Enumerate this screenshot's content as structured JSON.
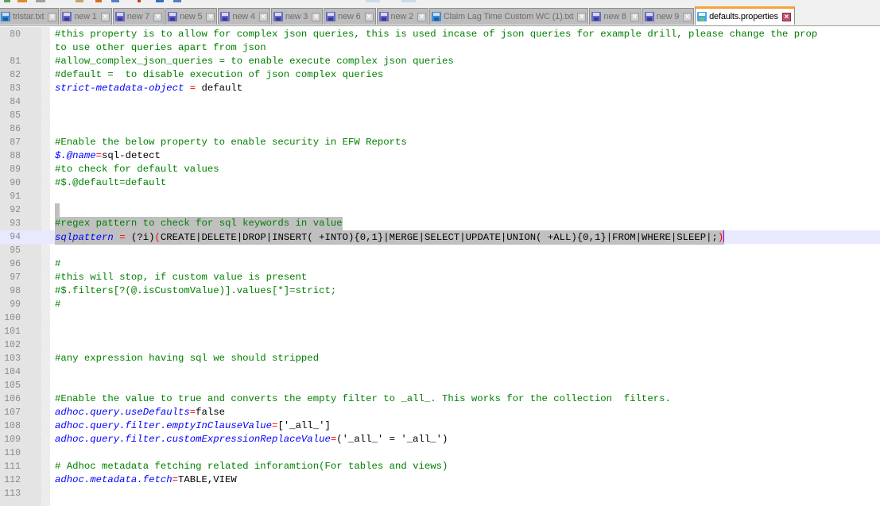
{
  "tabs": [
    {
      "label": "tristar.txt",
      "icon": "floppy-save-icon",
      "active": false
    },
    {
      "label": "new 1",
      "icon": "floppy-save-icon",
      "active": false
    },
    {
      "label": "new 7",
      "icon": "floppy-save-icon",
      "active": false
    },
    {
      "label": "new 5",
      "icon": "floppy-save-icon",
      "active": false
    },
    {
      "label": "new 4",
      "icon": "floppy-save-icon",
      "active": false
    },
    {
      "label": "new 3",
      "icon": "floppy-save-icon",
      "active": false
    },
    {
      "label": "new 6",
      "icon": "floppy-save-icon",
      "active": false
    },
    {
      "label": "new 2",
      "icon": "floppy-save-icon",
      "active": false
    },
    {
      "label": "Claim Lag Time Custom WC (1).txt",
      "icon": "floppy-save-icon",
      "active": false
    },
    {
      "label": "new 8",
      "icon": "floppy-save-icon",
      "active": false
    },
    {
      "label": "new 9",
      "icon": "floppy-save-icon",
      "active": false
    },
    {
      "label": "defaults.properties",
      "icon": "floppy-save-icon",
      "active": true
    }
  ],
  "colors": {
    "active_tab_accent": "#f7a13b",
    "comment": "#008000",
    "key": "#0000ff",
    "operator": "#ff0000",
    "selection": "#c0c0c0",
    "current_line": "#e8e8ff"
  },
  "editor": {
    "lines": [
      {
        "n": "80",
        "parts": [
          {
            "t": "comment",
            "v": "#this property is to allow for complex json queries, this is used incase of json queries for example drill, please change the prop"
          }
        ]
      },
      {
        "n": "",
        "parts": [
          {
            "t": "comment",
            "v": "to use other queries apart from json"
          }
        ]
      },
      {
        "n": "81",
        "parts": [
          {
            "t": "comment",
            "v": "#allow_complex_json_queries = to enable execute complex json queries"
          }
        ]
      },
      {
        "n": "82",
        "parts": [
          {
            "t": "comment",
            "v": "#default =  to disable execution of json complex queries"
          }
        ]
      },
      {
        "n": "83",
        "parts": [
          {
            "t": "key",
            "v": "strict-metadata-object "
          },
          {
            "t": "eq",
            "v": "="
          },
          {
            "t": "val",
            "v": " default"
          }
        ]
      },
      {
        "n": "84",
        "parts": []
      },
      {
        "n": "85",
        "parts": []
      },
      {
        "n": "86",
        "parts": []
      },
      {
        "n": "87",
        "parts": [
          {
            "t": "comment",
            "v": "#Enable the below property to enable security in EFW Reports"
          }
        ]
      },
      {
        "n": "88",
        "parts": [
          {
            "t": "key",
            "v": "$.@name"
          },
          {
            "t": "eq",
            "v": "="
          },
          {
            "t": "val",
            "v": "sql-detect"
          }
        ]
      },
      {
        "n": "89",
        "parts": [
          {
            "t": "comment",
            "v": "#to check for default values"
          }
        ]
      },
      {
        "n": "90",
        "parts": [
          {
            "t": "comment",
            "v": "#$.@default=default"
          }
        ]
      },
      {
        "n": "91",
        "parts": []
      },
      {
        "n": "92",
        "parts": [],
        "selected_empty": true
      },
      {
        "n": "93",
        "parts": [
          {
            "t": "comment",
            "v": "#regex pattern to check for sql keywords in value"
          }
        ],
        "selected": true
      },
      {
        "n": "94",
        "parts": [
          {
            "t": "key",
            "v": "sqlpattern "
          },
          {
            "t": "eq",
            "v": "="
          },
          {
            "t": "val",
            "v": " (?i)"
          },
          {
            "t": "paren",
            "v": "("
          },
          {
            "t": "val",
            "v": "CREATE|DELETE|DROP|INSERT( +INTO){0,1}|MERGE|SELECT|UPDATE|UNION( +ALL){0,1}|FROM|WHERE|SLEEP|;"
          },
          {
            "t": "paren",
            "v": ")"
          }
        ],
        "selected": true,
        "current": true,
        "caret": true
      },
      {
        "n": "95",
        "parts": []
      },
      {
        "n": "96",
        "parts": [
          {
            "t": "comment",
            "v": "#"
          }
        ]
      },
      {
        "n": "97",
        "parts": [
          {
            "t": "comment",
            "v": "#this will stop, if custom value is present"
          }
        ]
      },
      {
        "n": "98",
        "parts": [
          {
            "t": "comment",
            "v": "#$.filters[?(@.isCustomValue)].values[*]=strict;"
          }
        ]
      },
      {
        "n": "99",
        "parts": [
          {
            "t": "comment",
            "v": "#"
          }
        ]
      },
      {
        "n": "100",
        "parts": []
      },
      {
        "n": "101",
        "parts": []
      },
      {
        "n": "102",
        "parts": []
      },
      {
        "n": "103",
        "parts": [
          {
            "t": "comment",
            "v": "#any expression having sql we should stripped"
          }
        ]
      },
      {
        "n": "104",
        "parts": []
      },
      {
        "n": "105",
        "parts": []
      },
      {
        "n": "106",
        "parts": [
          {
            "t": "comment",
            "v": "#Enable the value to true and converts the empty filter to _all_. This works for the collection  filters."
          }
        ]
      },
      {
        "n": "107",
        "parts": [
          {
            "t": "key",
            "v": "adhoc.query.useDefaults"
          },
          {
            "t": "eq",
            "v": "="
          },
          {
            "t": "val",
            "v": "false"
          }
        ]
      },
      {
        "n": "108",
        "parts": [
          {
            "t": "key",
            "v": "adhoc.query.filter.emptyInClauseValue"
          },
          {
            "t": "eq",
            "v": "="
          },
          {
            "t": "val",
            "v": "['_all_']"
          }
        ]
      },
      {
        "n": "109",
        "parts": [
          {
            "t": "key",
            "v": "adhoc.query.filter.customExpressionReplaceValue"
          },
          {
            "t": "eq",
            "v": "="
          },
          {
            "t": "val",
            "v": "('_all_' = '_all_')"
          }
        ]
      },
      {
        "n": "110",
        "parts": []
      },
      {
        "n": "111",
        "parts": [
          {
            "t": "comment",
            "v": "# Adhoc metadata fetching related inforamtion(For tables and views)"
          }
        ]
      },
      {
        "n": "112",
        "parts": [
          {
            "t": "key",
            "v": "adhoc.metadata.fetch"
          },
          {
            "t": "eq",
            "v": "="
          },
          {
            "t": "val",
            "v": "TABLE,VIEW"
          }
        ]
      },
      {
        "n": "113",
        "parts": []
      }
    ]
  }
}
